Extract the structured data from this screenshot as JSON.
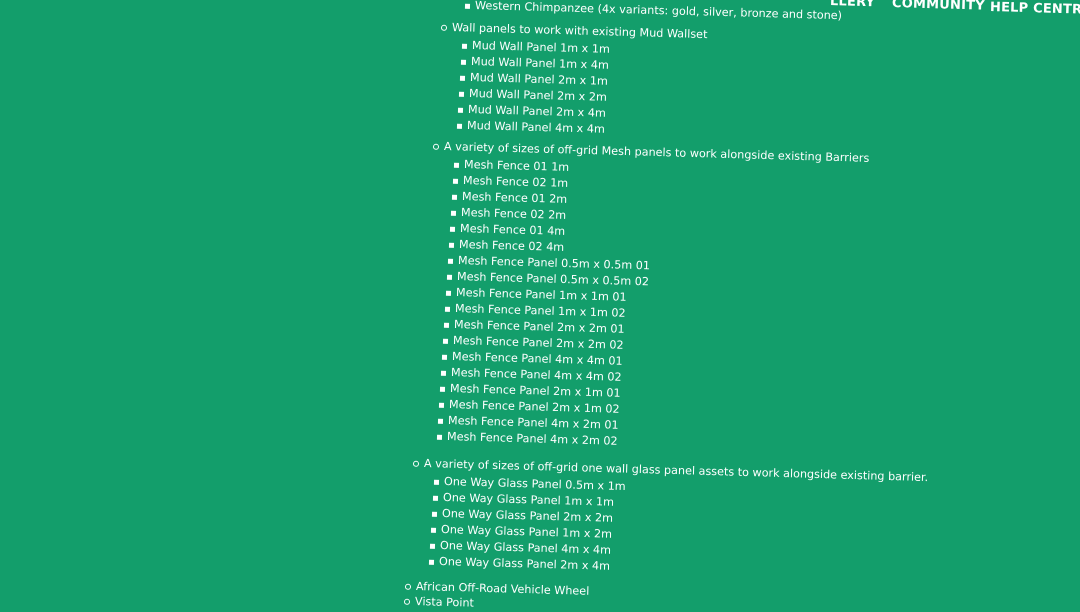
{
  "nav": {
    "gallery_partial": "LLERY",
    "community": "COMMUNITY",
    "help_centre": "HELP CENTRE"
  },
  "content": {
    "chimp_item": "Western Chimpanzee (4x variants: gold, silver, bronze and stone)",
    "groups": [
      {
        "title": "Wall panels to work with existing Mud Wallset",
        "items": [
          "Mud Wall Panel 1m x 1m",
          "Mud Wall Panel 1m x 4m",
          "Mud Wall Panel 2m x 1m",
          "Mud Wall Panel 2m x 2m",
          "Mud Wall Panel 2m x 4m",
          "Mud Wall Panel 4m x 4m"
        ]
      },
      {
        "title": "A variety of sizes of off-grid Mesh panels to work alongside existing Barriers",
        "items": [
          "Mesh Fence 01 1m",
          "Mesh Fence 02 1m",
          "Mesh Fence 01 2m",
          "Mesh Fence 02 2m",
          "Mesh Fence 01 4m",
          "Mesh Fence 02 4m",
          "Mesh Fence Panel 0.5m x 0.5m 01",
          "Mesh Fence Panel 0.5m x 0.5m 02",
          "Mesh Fence Panel 1m x 1m 01",
          "Mesh Fence Panel 1m x 1m 02",
          "Mesh Fence Panel 2m x 2m 01",
          "Mesh Fence Panel 2m x 2m 02",
          "Mesh Fence Panel 4m x 4m 01",
          "Mesh Fence Panel 4m x 4m 02",
          "Mesh Fence Panel 2m x 1m 01",
          "Mesh Fence Panel 2m x 1m 02",
          "Mesh Fence Panel 4m x 2m 01",
          "Mesh Fence Panel 4m x 2m 02"
        ]
      },
      {
        "title": "A variety of sizes of off-grid one wall glass panel assets to work alongside existing barrier.",
        "items": [
          "One Way Glass Panel 0.5m x 1m",
          "One Way Glass Panel 1m x 1m",
          "One Way Glass Panel 2m x 2m",
          "One Way Glass Panel 1m x 2m",
          "One Way Glass Panel 4m x 4m",
          "One Way Glass Panel 2m x 4m"
        ]
      }
    ],
    "trailing_items": [
      "African Off-Road Vehicle Wheel",
      "Vista Point"
    ]
  },
  "colors": {
    "background": "#139e6b",
    "text": "#ffffff"
  }
}
